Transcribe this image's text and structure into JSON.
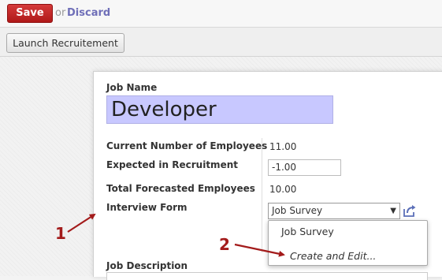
{
  "toolbar": {
    "save_label": "Save",
    "or_text": "or",
    "discard_label": "Discard",
    "launch_label": "Launch Recruitement"
  },
  "form": {
    "job_name_label": "Job Name",
    "job_name_value": "Developer",
    "current_employees_label": "Current Number of Employees",
    "current_employees_value": "11.00",
    "expected_label": "Expected in Recruitment",
    "expected_value": "-1.00",
    "forecast_label": "Total Forecasted Employees",
    "forecast_value": "10.00",
    "interview_label": "Interview Form",
    "interview_value": "Job Survey",
    "description_label": "Job Description"
  },
  "dropdown": {
    "options": [
      "Job Survey",
      "Create and Edit..."
    ]
  },
  "annotations": {
    "marker_1": "1",
    "marker_2": "2",
    "color": "#a31b1b"
  },
  "colors": {
    "save_button": "#c62828",
    "job_name_highlight": "#c8c8ff",
    "link": "#6f6fb8"
  },
  "icons": {
    "select_arrow": "triangle-down-icon",
    "external_link": "external-link-icon"
  }
}
